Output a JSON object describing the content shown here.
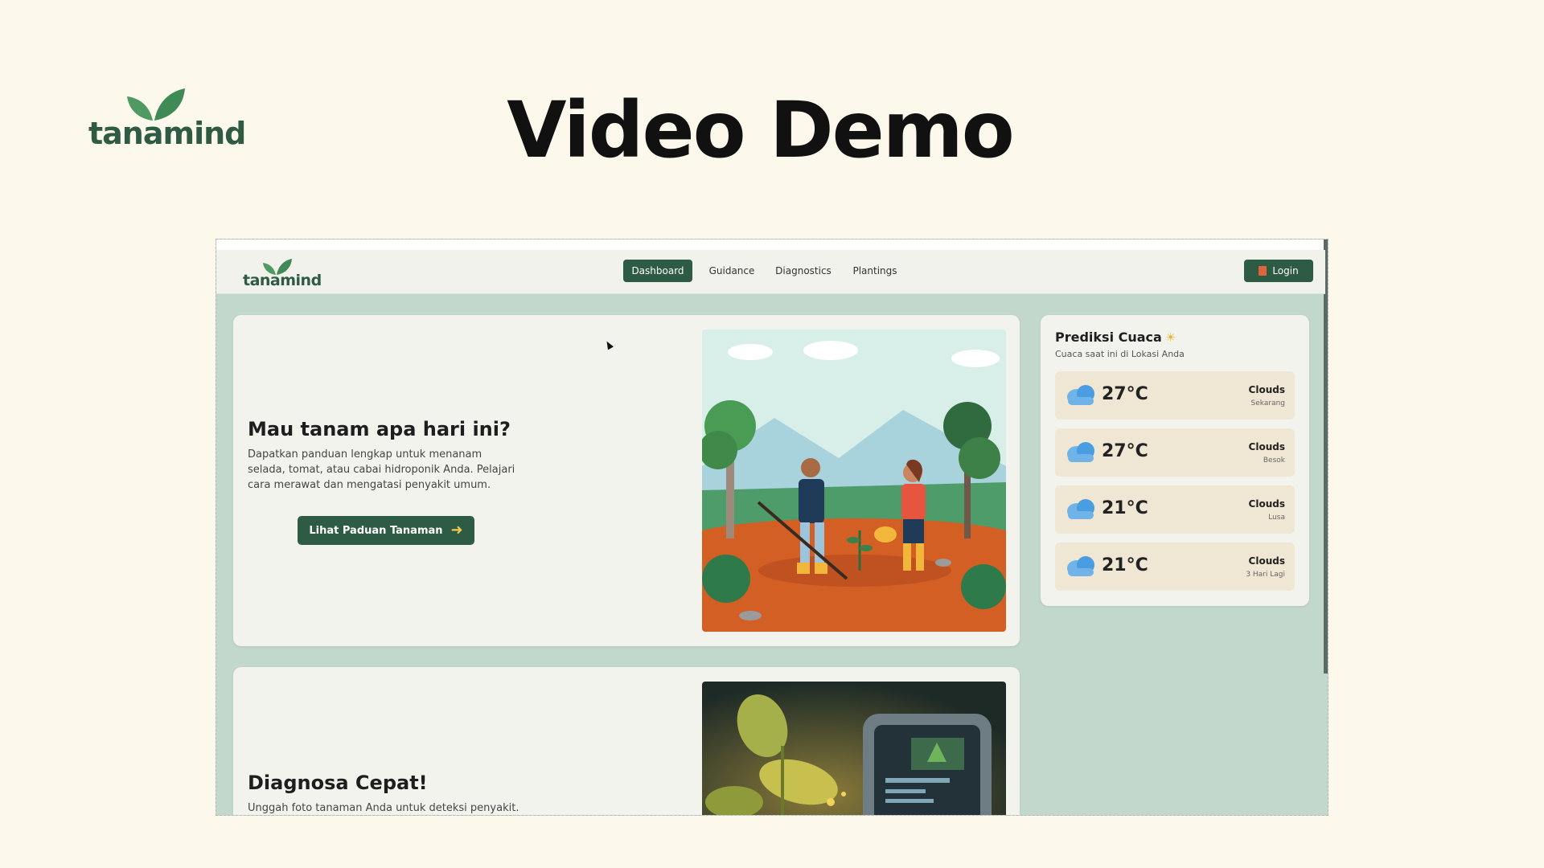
{
  "slide": {
    "logo_text": "tanamind",
    "title": "Video Demo"
  },
  "app": {
    "logo_text": "tanamind",
    "nav": {
      "items": [
        {
          "label": "Dashboard",
          "active": true
        },
        {
          "label": "Guidance",
          "active": false
        },
        {
          "label": "Diagnostics",
          "active": false
        },
        {
          "label": "Plantings",
          "active": false
        }
      ],
      "login_label": "Login"
    },
    "hero": {
      "title": "Mau tanam apa hari ini?",
      "description": "Dapatkan panduan lengkap untuk menanam selada, tomat, atau cabai hidroponik Anda. Pelajari cara merawat dan mengatasi penyakit umum.",
      "button_label": "Lihat Paduan Tanaman"
    },
    "diagnosis": {
      "title": "Diagnosa Cepat!",
      "description": "Unggah foto tanaman Anda untuk deteksi penyakit."
    },
    "weather": {
      "title": "Prediksi Cuaca",
      "subtitle": "Cuaca saat ini di Lokasi Anda",
      "rows": [
        {
          "temp": "27°C",
          "condition": "Clouds",
          "when": "Sekarang"
        },
        {
          "temp": "27°C",
          "condition": "Clouds",
          "when": "Besok"
        },
        {
          "temp": "21°C",
          "condition": "Clouds",
          "when": "Lusa"
        },
        {
          "temp": "21°C",
          "condition": "Clouds",
          "when": "3 Hari Lagi"
        }
      ]
    }
  },
  "colors": {
    "brand_green": "#2e5b44",
    "slide_bg": "#fdf8ec",
    "app_bg": "#c2d8cc",
    "weather_row_bg": "#efe7d3"
  },
  "icons": [
    "leaf-logo-icon",
    "door-login-icon",
    "arrow-right-icon",
    "sun-cloud-icon",
    "cloud-icon"
  ]
}
